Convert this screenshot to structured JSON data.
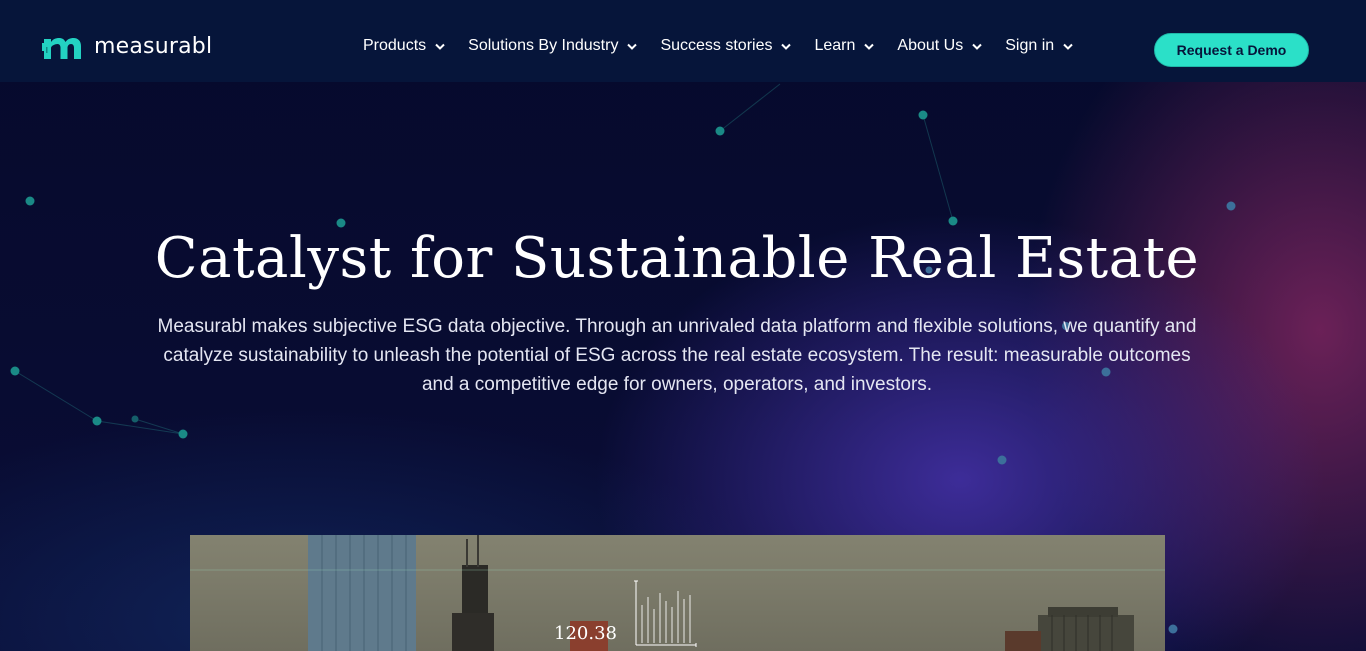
{
  "brand": {
    "name": "measurabl",
    "accent": "#2be0c8",
    "nav_bg": "#06153a"
  },
  "nav": {
    "items": [
      {
        "label": "Products",
        "icon": "chevron-down-icon"
      },
      {
        "label": "Solutions By Industry",
        "icon": "chevron-down-icon"
      },
      {
        "label": "Success stories",
        "icon": "chevron-down-icon"
      },
      {
        "label": "Learn",
        "icon": "chevron-down-icon"
      },
      {
        "label": "About Us",
        "icon": "chevron-down-icon"
      },
      {
        "label": "Sign in",
        "icon": "chevron-down-icon"
      }
    ],
    "cta_label": "Request a Demo"
  },
  "hero": {
    "title": "Catalyst for Sustainable Real Estate",
    "subtitle": "Measurabl makes subjective ESG data objective. Through an unrivaled data platform and flexible solutions, we quantify and catalyze sustainability to unleash the potential of ESG across the real estate ecosystem. The result: measurable outcomes and a competitive edge for owners, operators, and investors."
  },
  "media": {
    "overlay_value": "120.38"
  }
}
